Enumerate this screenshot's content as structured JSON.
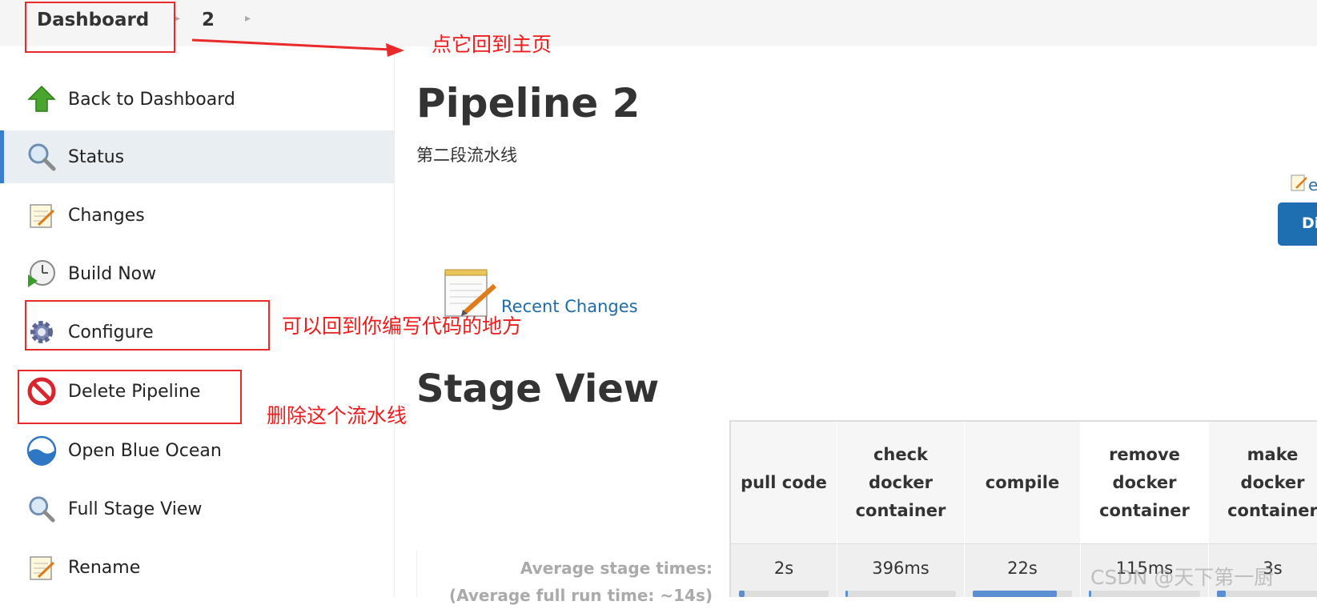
{
  "breadcrumb": {
    "items": [
      "Dashboard",
      "2"
    ]
  },
  "sidebar": {
    "items": [
      {
        "label": "Back to Dashboard",
        "icon": "up-arrow-icon"
      },
      {
        "label": "Status",
        "icon": "magnifier-icon",
        "active": true
      },
      {
        "label": "Changes",
        "icon": "notepad-icon"
      },
      {
        "label": "Build Now",
        "icon": "clock-play-icon"
      },
      {
        "label": "Configure",
        "icon": "gear-icon"
      },
      {
        "label": "Delete Pipeline",
        "icon": "no-entry-icon"
      },
      {
        "label": "Open Blue Ocean",
        "icon": "blue-ocean-icon"
      },
      {
        "label": "Full Stage View",
        "icon": "magnifier-icon"
      },
      {
        "label": "Rename",
        "icon": "notepad-icon"
      }
    ]
  },
  "main": {
    "title": "Pipeline 2",
    "description": "第二段流水线",
    "edit_description_label": "e",
    "disable_button_label": "Di",
    "recent_changes_label": "Recent Changes",
    "stage_view_title": "Stage View",
    "average_stage_times_label": "Average stage times:",
    "average_full_run_label": "(Average full run time: ~14s)"
  },
  "stages": [
    {
      "name": "pull code",
      "time": "2s",
      "fill": 0.06
    },
    {
      "name": "check docker container",
      "time": "396ms",
      "fill": 0.02
    },
    {
      "name": "compile",
      "time": "22s",
      "fill": 0.85
    },
    {
      "name": "remove docker container",
      "time": "115ms",
      "fill": 0.01
    },
    {
      "name": "make docker container",
      "time": "3s",
      "fill": 0.08
    }
  ],
  "annotations": {
    "home_note": "点它回到主页",
    "configure_note": "可以回到你编写代码的地方",
    "delete_note": "删除这个流水线"
  },
  "watermark": "CSDN @天下第一厨",
  "colors": {
    "accent": "#1d6fb2",
    "link": "#1f6aa8",
    "annotation": "#ee1d1d",
    "active_bg": "#e9eef3",
    "progress": "#5b8fd1"
  }
}
